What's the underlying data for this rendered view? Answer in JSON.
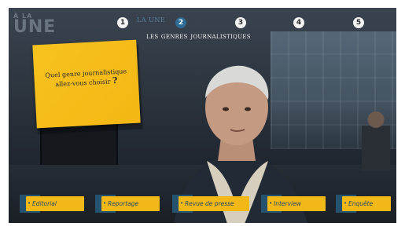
{
  "logo": {
    "small": "À LA",
    "big": "UNE"
  },
  "steps": {
    "items": [
      "1",
      "2",
      "3",
      "4",
      "5"
    ],
    "active_index": 1,
    "previous_label": "LA UNE",
    "section_title": "les genres journalistiques"
  },
  "note": {
    "line1": "Quel genre journalistique",
    "line2": "allez-vous choisir",
    "mark": "?"
  },
  "choices": [
    {
      "label": "Editorial"
    },
    {
      "label": "Reportage"
    },
    {
      "label": "Revue de presse"
    },
    {
      "label": "Interview"
    },
    {
      "label": "Enquête"
    }
  ],
  "colors": {
    "accent_yellow": "#f2b817",
    "accent_blue": "#24526f",
    "active_step": "#2f6c93"
  }
}
